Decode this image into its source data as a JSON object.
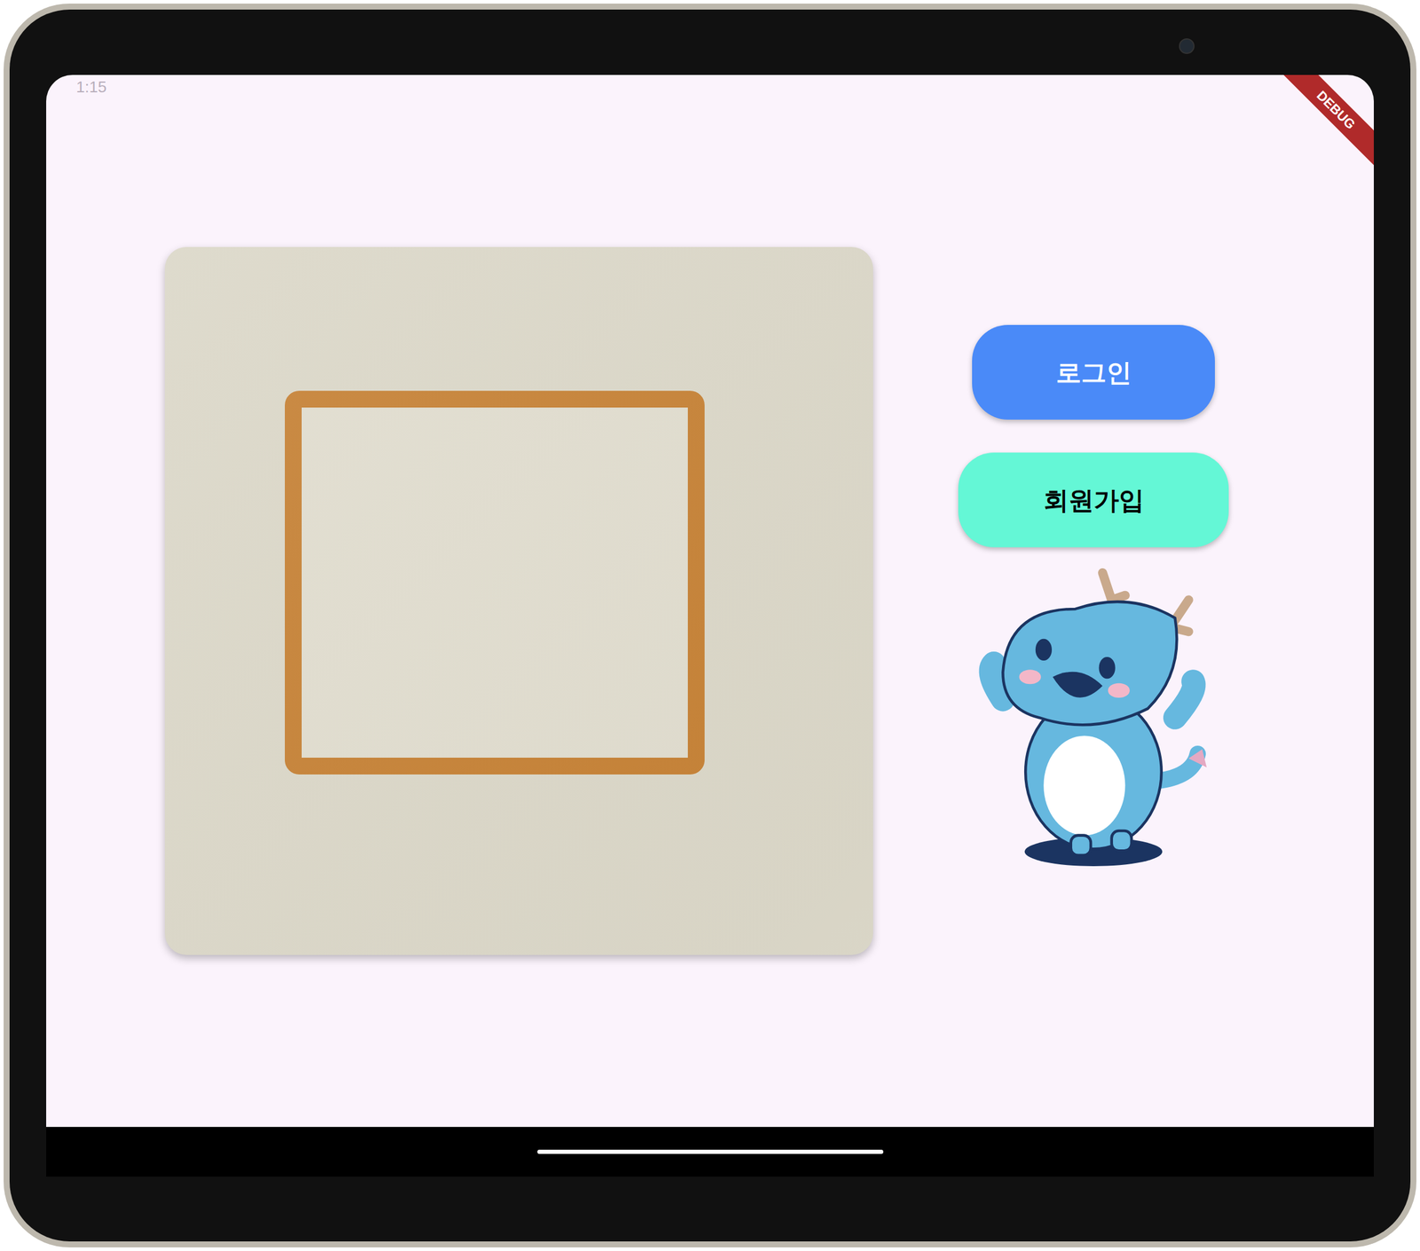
{
  "status_bar": {
    "time": "1:15"
  },
  "debug_banner": "DEBUG",
  "hero_image": {
    "alt": "logo"
  },
  "buttons": [
    {
      "label": "로그인",
      "kind": "primary"
    },
    {
      "label": "회원가입",
      "kind": "secondary"
    }
  ]
}
